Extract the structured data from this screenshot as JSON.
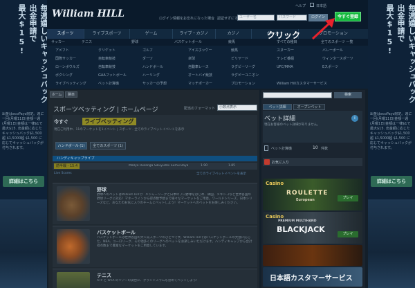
{
  "left_banner": {
    "col1": "毎週嬉しいキャッシュバック",
    "col2": "出金申請で",
    "col3": "最大$15!",
    "small_text": "出金はecoPayz限定。週に一回(月曜11日)金額一週(月曜1日)金額は一律$1で最大$15. 出金額に応じたキャッシュバック$1,500超 $1,5000超 $1,500 に応じてキャッシュバックが付与されます。",
    "cta": "詳細はこちら"
  },
  "right_banner": {
    "col1": "毎週嬉しいキャッシュバック",
    "col2": "出金申請で",
    "col3": "最大$15!",
    "small_text": "出金はecoPayz限定。週に一回(月曜11日)金額一週(月曜1日)金額は一律$1で最大$15. 出金額に応じたキャッシュバック$1,500超 $1,5000超 $1,500 に応じてキャッシュバックが付与されます。",
    "cta": "詳細はこちら"
  },
  "header": {
    "logo": "William HILL",
    "help": "ヘルプ",
    "lang": "日本語",
    "login_help": "ログイン情報をお忘れになった場合",
    "remember": "認証せずにすます",
    "username_placeholder": "ユーザー名",
    "password_placeholder": "パスワード",
    "login_button": "ログイン",
    "join_button": "今すぐ登録",
    "annotation": "クリック"
  },
  "nav": {
    "items": [
      "スポーツ",
      "ライブスポーツ",
      "ゲーム",
      "ライブ・カジノ",
      "カジノ",
      "ポーカー",
      "プロモーション"
    ]
  },
  "menu": {
    "head": [
      "サッカー",
      "テニス",
      "野球",
      "バスケットボール",
      "競馬",
      "すべての種目",
      "全てのスポーツ 一覧"
    ],
    "col1": [
      "アメフト",
      "国際サッカー",
      "ローンボウルズ",
      "ボクシング",
      "ライブベッティング"
    ],
    "col2": [
      "クリケット",
      "自転車競技",
      "自転車競技",
      "GAAフットボール",
      "ベット計算機"
    ],
    "col3": [
      "ゴルフ",
      "ダーツ",
      "ハンドボール",
      "ハーリング",
      "サッカーの予想"
    ],
    "col4": [
      "アイスホッケー",
      "卓球",
      "自動車レース",
      "オートバイ競技",
      "マッチポーカー"
    ],
    "col5": [
      "競馬",
      "ビリヤード",
      "ラグビーリーグ",
      "ラグビーユニオン",
      "プロモーション"
    ],
    "col6": [
      "スヌーカー",
      "テレビ番組",
      "UFC/MMA",
      "",
      "William Hillカスタマーサービス"
    ],
    "col7": [
      "バレーボール",
      "ウィンタースポーツ",
      "Eスポーツ",
      "",
      ""
    ]
  },
  "content": {
    "tabs": [
      "ホーム",
      "勝率"
    ],
    "page_title": "スポーツベッティング | ホームページ",
    "odds_format_label": "配当のフォーマット",
    "odds_format_value": "小数点表示",
    "section_title_a": "今すぐ",
    "section_title_b": "ライブベッティング",
    "header_link": "現在ご利用中、11のマーケットを1イベント | スポーツ - 全てのライブベットイベントを表示",
    "filters": [
      "ハンドボール (1)",
      "全てのスポーツ (1)"
    ],
    "band": "ハンディキャップライブ",
    "odd_label": "前半戦 - 15:4",
    "match_text": "Mallye Rusanga Sikuyuzlei Sumu Bayakalpu vs. SGK",
    "odd_a": "1.90",
    "odd_b": "1.85",
    "under_left": "Live Scores",
    "under_right": "全てのライブベットイベントを表示"
  },
  "sports": [
    {
      "title": "野球",
      "desc": "野球へのベットはWilliam Hillで！メジャーリーグと日本のプロ野球をはじめ、韓国、メキシコなど世界各国の野球リーグに対応！マネーラインから得点数予想まで様々なマーケットをご用意。ワールドシリーズ、日本シリーズなど、あなたのお気に入りのチームにベットしよう！マーケットへのベットをお楽しみください。"
    },
    {
      "title": "バスケットボール",
      "desc": "バスケットボールは世界各国の大人気スポーツのひとつです。William Hillではバスケットボールの大会に応じた、NBA、ユーロリーグ、その他多くのリーグへのベットをお楽しみいただけます。ハンディキャップから合計得点数まで豊富なマーケットをご用意しています。"
    },
    {
      "title": "テニス",
      "desc": "ATP と WTA のツアーの試合に、グランドスラムも含めてベットしよう！"
    }
  ],
  "sidebar": {
    "tabs": [
      "ベット詳細",
      "オープンベット"
    ],
    "bet_title": "ベット詳細",
    "bet_note": "現在お客様のベット詳細がありません。",
    "calc_label": "ベット計算機",
    "calc_count": "10",
    "calc_unit": "件数",
    "fav_label": "お気に入り",
    "search_button": "検索",
    "promos": [
      {
        "label": "Casino",
        "name": "ROULETTE",
        "sub": "European",
        "play": "プレイ"
      },
      {
        "label": "Casino",
        "name": "BLACKJACK",
        "sub": "PREMIUM MULTIHAND",
        "play": "プレイ"
      },
      {
        "label": "",
        "name": "",
        "sub": "",
        "play": ""
      },
      {
        "label": "",
        "name": "日本語カスタマーサービス",
        "sub": "",
        "play": ""
      }
    ]
  },
  "colors": {
    "join_green": "#15ba3e",
    "callout_arrow": "#e8222c",
    "nav_blue": "#0f4f80"
  }
}
